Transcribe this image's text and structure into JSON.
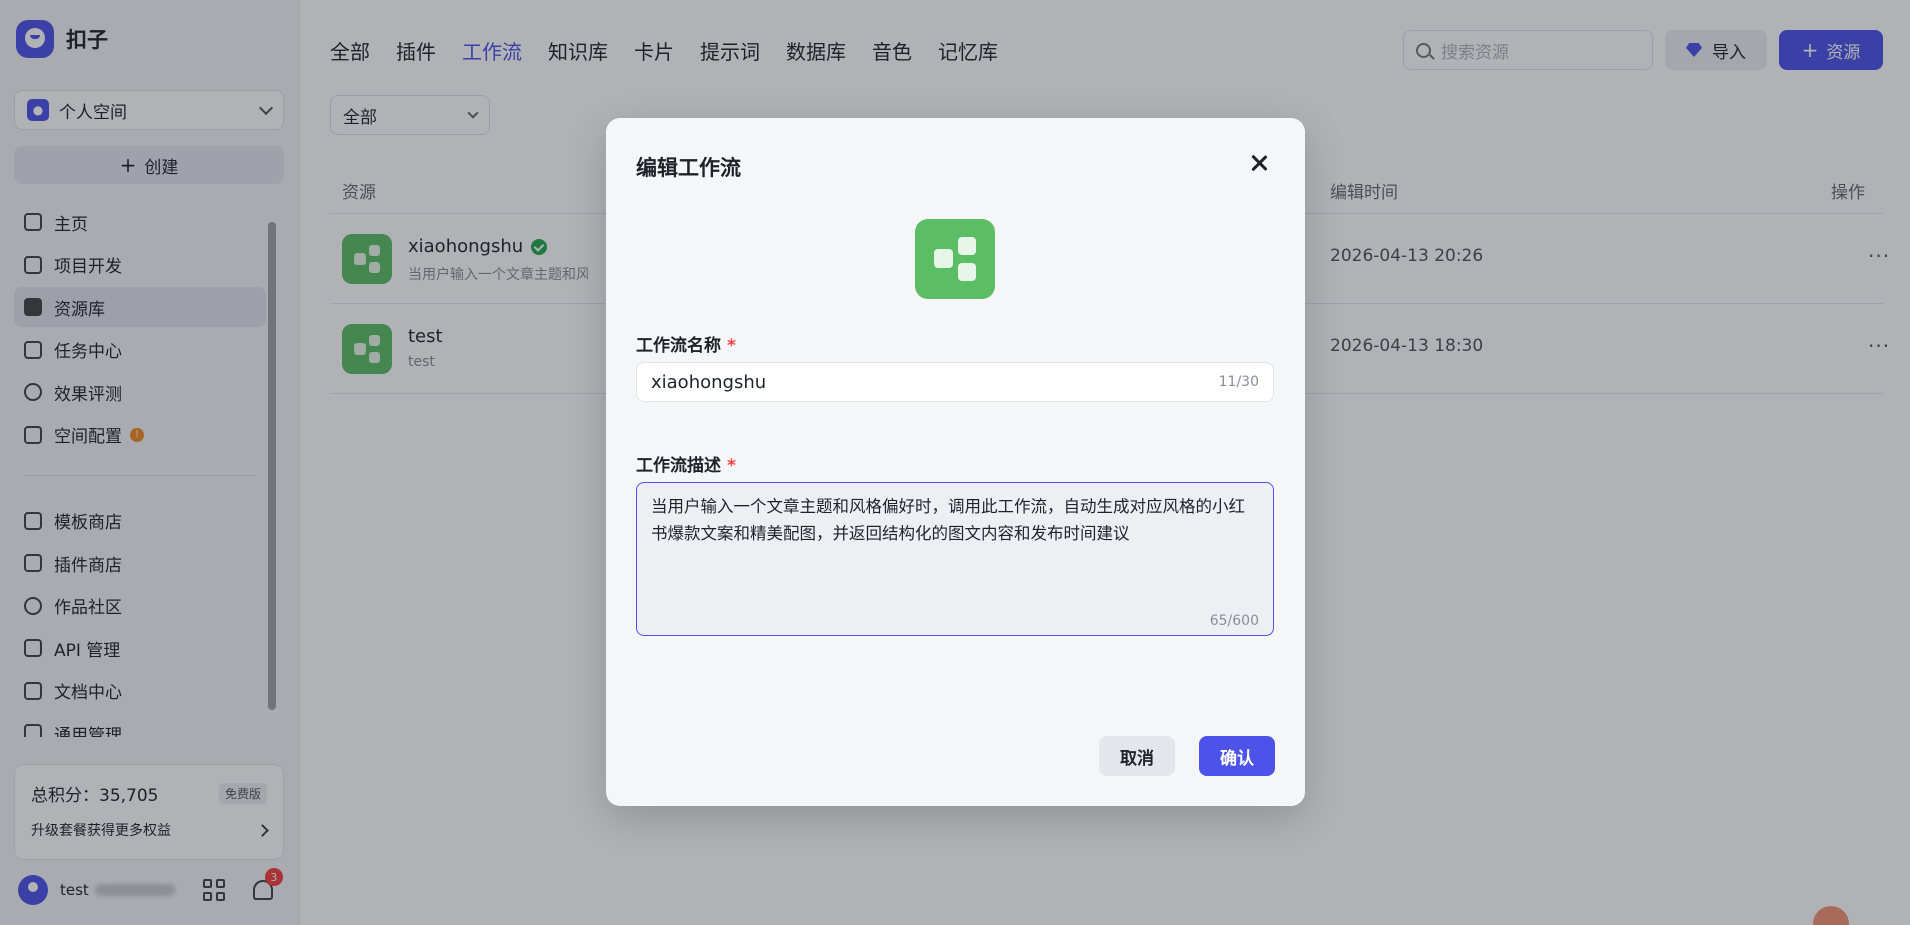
{
  "brand": {
    "name": "扣子"
  },
  "space_select": {
    "label": "个人空间"
  },
  "create_button": {
    "label": "创建"
  },
  "nav": {
    "items": [
      {
        "label": "主页",
        "icon": "home-icon"
      },
      {
        "label": "项目开发",
        "icon": "robot-icon"
      },
      {
        "label": "资源库",
        "icon": "library-icon",
        "active": true
      },
      {
        "label": "任务中心",
        "icon": "task-icon"
      },
      {
        "label": "效果评测",
        "icon": "gauge-icon"
      },
      {
        "label": "空间配置",
        "icon": "terminal-icon",
        "badge": "!"
      },
      {
        "label": "模板商店",
        "icon": "template-icon"
      },
      {
        "label": "插件商店",
        "icon": "plugin-icon"
      },
      {
        "label": "作品社区",
        "icon": "community-icon"
      },
      {
        "label": "API 管理",
        "icon": "api-icon"
      },
      {
        "label": "文档中心",
        "icon": "doc-icon"
      },
      {
        "label": "通用管理",
        "icon": "settings-icon"
      }
    ]
  },
  "credits": {
    "label": "总积分：35,705",
    "plan": "免费版",
    "upgrade": "升级套餐获得更多权益"
  },
  "user": {
    "name": "test",
    "notifications": "3"
  },
  "tabs": [
    "全部",
    "插件",
    "工作流",
    "知识库",
    "卡片",
    "提示词",
    "数据库",
    "音色",
    "记忆库"
  ],
  "active_tab": "工作流",
  "search": {
    "placeholder": "搜索资源"
  },
  "toolbar": {
    "import_label": "导入",
    "resource_label": "资源"
  },
  "filter": {
    "value": "全部"
  },
  "table": {
    "headers": {
      "resource": "资源",
      "edit_time": "编辑时间",
      "actions": "操作"
    },
    "rows": [
      {
        "name": "xiaohongshu",
        "desc": "当用户输入一个文章主题和风格偏好时…",
        "time": "2026-04-13 20:26",
        "verified": true
      },
      {
        "name": "test",
        "desc": "test",
        "time": "2026-04-13 18:30",
        "verified": false
      }
    ]
  },
  "modal": {
    "title": "编辑工作流",
    "name_label": "工作流名称",
    "name_value": "xiaohongshu",
    "name_counter": "11/30",
    "desc_label": "工作流描述",
    "desc_value": "当用户输入一个文章主题和风格偏好时，调用此工作流，自动生成对应风格的小红书爆款文案和精美配图，并返回结构化的图文内容和发布时间建议",
    "desc_counter": "65/600",
    "cancel_label": "取消",
    "confirm_label": "确认"
  },
  "colors": {
    "accent": "#4d53e8",
    "workflow_icon": "#5cbe64",
    "required": "#f53f3f",
    "warn": "#f08a24"
  }
}
